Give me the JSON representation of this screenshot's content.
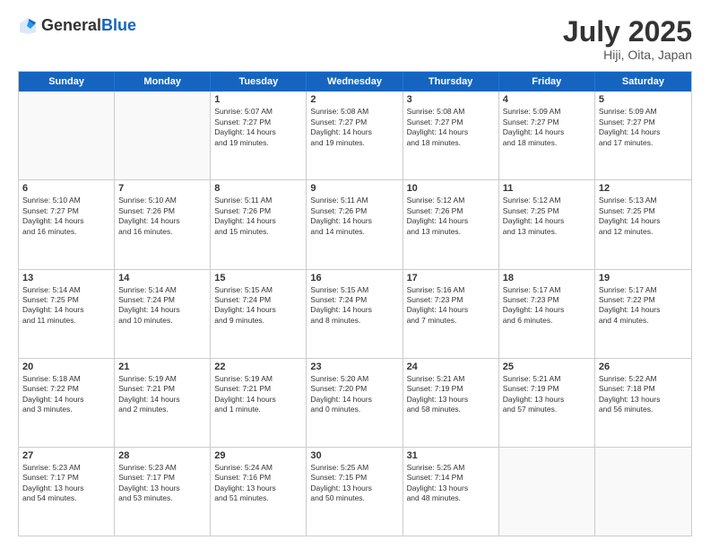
{
  "header": {
    "logo_general": "General",
    "logo_blue": "Blue",
    "title": "July 2025",
    "subtitle": "Hiji, Oita, Japan"
  },
  "days_of_week": [
    "Sunday",
    "Monday",
    "Tuesday",
    "Wednesday",
    "Thursday",
    "Friday",
    "Saturday"
  ],
  "weeks": [
    [
      {
        "day": "",
        "empty": true
      },
      {
        "day": "",
        "empty": true
      },
      {
        "day": "1",
        "lines": [
          "Sunrise: 5:07 AM",
          "Sunset: 7:27 PM",
          "Daylight: 14 hours",
          "and 19 minutes."
        ]
      },
      {
        "day": "2",
        "lines": [
          "Sunrise: 5:08 AM",
          "Sunset: 7:27 PM",
          "Daylight: 14 hours",
          "and 19 minutes."
        ]
      },
      {
        "day": "3",
        "lines": [
          "Sunrise: 5:08 AM",
          "Sunset: 7:27 PM",
          "Daylight: 14 hours",
          "and 18 minutes."
        ]
      },
      {
        "day": "4",
        "lines": [
          "Sunrise: 5:09 AM",
          "Sunset: 7:27 PM",
          "Daylight: 14 hours",
          "and 18 minutes."
        ]
      },
      {
        "day": "5",
        "lines": [
          "Sunrise: 5:09 AM",
          "Sunset: 7:27 PM",
          "Daylight: 14 hours",
          "and 17 minutes."
        ]
      }
    ],
    [
      {
        "day": "6",
        "lines": [
          "Sunrise: 5:10 AM",
          "Sunset: 7:27 PM",
          "Daylight: 14 hours",
          "and 16 minutes."
        ]
      },
      {
        "day": "7",
        "lines": [
          "Sunrise: 5:10 AM",
          "Sunset: 7:26 PM",
          "Daylight: 14 hours",
          "and 16 minutes."
        ]
      },
      {
        "day": "8",
        "lines": [
          "Sunrise: 5:11 AM",
          "Sunset: 7:26 PM",
          "Daylight: 14 hours",
          "and 15 minutes."
        ]
      },
      {
        "day": "9",
        "lines": [
          "Sunrise: 5:11 AM",
          "Sunset: 7:26 PM",
          "Daylight: 14 hours",
          "and 14 minutes."
        ]
      },
      {
        "day": "10",
        "lines": [
          "Sunrise: 5:12 AM",
          "Sunset: 7:26 PM",
          "Daylight: 14 hours",
          "and 13 minutes."
        ]
      },
      {
        "day": "11",
        "lines": [
          "Sunrise: 5:12 AM",
          "Sunset: 7:25 PM",
          "Daylight: 14 hours",
          "and 13 minutes."
        ]
      },
      {
        "day": "12",
        "lines": [
          "Sunrise: 5:13 AM",
          "Sunset: 7:25 PM",
          "Daylight: 14 hours",
          "and 12 minutes."
        ]
      }
    ],
    [
      {
        "day": "13",
        "lines": [
          "Sunrise: 5:14 AM",
          "Sunset: 7:25 PM",
          "Daylight: 14 hours",
          "and 11 minutes."
        ]
      },
      {
        "day": "14",
        "lines": [
          "Sunrise: 5:14 AM",
          "Sunset: 7:24 PM",
          "Daylight: 14 hours",
          "and 10 minutes."
        ]
      },
      {
        "day": "15",
        "lines": [
          "Sunrise: 5:15 AM",
          "Sunset: 7:24 PM",
          "Daylight: 14 hours",
          "and 9 minutes."
        ]
      },
      {
        "day": "16",
        "lines": [
          "Sunrise: 5:15 AM",
          "Sunset: 7:24 PM",
          "Daylight: 14 hours",
          "and 8 minutes."
        ]
      },
      {
        "day": "17",
        "lines": [
          "Sunrise: 5:16 AM",
          "Sunset: 7:23 PM",
          "Daylight: 14 hours",
          "and 7 minutes."
        ]
      },
      {
        "day": "18",
        "lines": [
          "Sunrise: 5:17 AM",
          "Sunset: 7:23 PM",
          "Daylight: 14 hours",
          "and 6 minutes."
        ]
      },
      {
        "day": "19",
        "lines": [
          "Sunrise: 5:17 AM",
          "Sunset: 7:22 PM",
          "Daylight: 14 hours",
          "and 4 minutes."
        ]
      }
    ],
    [
      {
        "day": "20",
        "lines": [
          "Sunrise: 5:18 AM",
          "Sunset: 7:22 PM",
          "Daylight: 14 hours",
          "and 3 minutes."
        ]
      },
      {
        "day": "21",
        "lines": [
          "Sunrise: 5:19 AM",
          "Sunset: 7:21 PM",
          "Daylight: 14 hours",
          "and 2 minutes."
        ]
      },
      {
        "day": "22",
        "lines": [
          "Sunrise: 5:19 AM",
          "Sunset: 7:21 PM",
          "Daylight: 14 hours",
          "and 1 minute."
        ]
      },
      {
        "day": "23",
        "lines": [
          "Sunrise: 5:20 AM",
          "Sunset: 7:20 PM",
          "Daylight: 14 hours",
          "and 0 minutes."
        ]
      },
      {
        "day": "24",
        "lines": [
          "Sunrise: 5:21 AM",
          "Sunset: 7:19 PM",
          "Daylight: 13 hours",
          "and 58 minutes."
        ]
      },
      {
        "day": "25",
        "lines": [
          "Sunrise: 5:21 AM",
          "Sunset: 7:19 PM",
          "Daylight: 13 hours",
          "and 57 minutes."
        ]
      },
      {
        "day": "26",
        "lines": [
          "Sunrise: 5:22 AM",
          "Sunset: 7:18 PM",
          "Daylight: 13 hours",
          "and 56 minutes."
        ]
      }
    ],
    [
      {
        "day": "27",
        "lines": [
          "Sunrise: 5:23 AM",
          "Sunset: 7:17 PM",
          "Daylight: 13 hours",
          "and 54 minutes."
        ]
      },
      {
        "day": "28",
        "lines": [
          "Sunrise: 5:23 AM",
          "Sunset: 7:17 PM",
          "Daylight: 13 hours",
          "and 53 minutes."
        ]
      },
      {
        "day": "29",
        "lines": [
          "Sunrise: 5:24 AM",
          "Sunset: 7:16 PM",
          "Daylight: 13 hours",
          "and 51 minutes."
        ]
      },
      {
        "day": "30",
        "lines": [
          "Sunrise: 5:25 AM",
          "Sunset: 7:15 PM",
          "Daylight: 13 hours",
          "and 50 minutes."
        ]
      },
      {
        "day": "31",
        "lines": [
          "Sunrise: 5:25 AM",
          "Sunset: 7:14 PM",
          "Daylight: 13 hours",
          "and 48 minutes."
        ]
      },
      {
        "day": "",
        "empty": true
      },
      {
        "day": "",
        "empty": true
      }
    ]
  ]
}
